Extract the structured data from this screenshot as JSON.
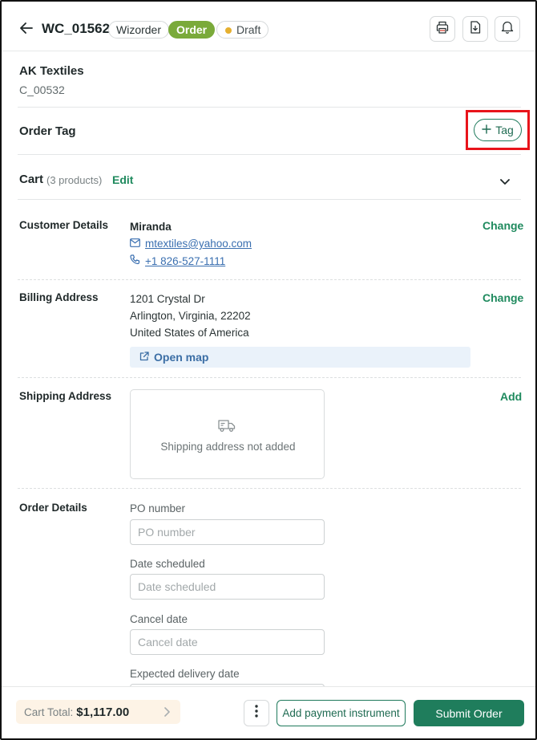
{
  "header": {
    "order_id": "WC_01562",
    "source_pill": "Wizorder",
    "type_pill": "Order",
    "status_pill": "Draft",
    "icons": [
      "back-arrow-icon",
      "printer-icon",
      "download-icon",
      "bell-icon"
    ]
  },
  "customer": {
    "company": "AK Textiles",
    "code": "C_00532"
  },
  "order_tag": {
    "title": "Order Tag",
    "add_label": "Tag"
  },
  "cart": {
    "title": "Cart",
    "count": "(3 products)",
    "edit_label": "Edit"
  },
  "customer_details": {
    "label": "Customer Details",
    "name": "Miranda",
    "email": "mtextiles@yahoo.com",
    "phone": "+1 826-527-1111",
    "action": "Change"
  },
  "billing": {
    "label": "Billing Address",
    "line1": "1201 Crystal Dr",
    "line2": "Arlington, Virginia, 22202",
    "line3": "United States of America",
    "map_label": "Open map",
    "action": "Change"
  },
  "shipping": {
    "label": "Shipping Address",
    "empty_message": "Shipping address not added",
    "action": "Add"
  },
  "order_details": {
    "label": "Order Details",
    "po_label": "PO number",
    "po_placeholder": "PO number",
    "date_label": "Date scheduled",
    "date_placeholder": "Date scheduled",
    "cancel_label": "Cancel date",
    "cancel_placeholder": "Cancel date",
    "delivery_label": "Expected delivery date"
  },
  "footer": {
    "total_label": "Cart Total:",
    "total_value": "$1,117.00",
    "pay_label": "Add payment instrument",
    "submit_label": "Submit Order"
  },
  "colors": {
    "accent_green": "#1f7d5c",
    "order_pill": "#7aaa3a",
    "draft_dot": "#e6b030",
    "highlight": "#e8141b",
    "link_blue": "#3a6fb0"
  }
}
